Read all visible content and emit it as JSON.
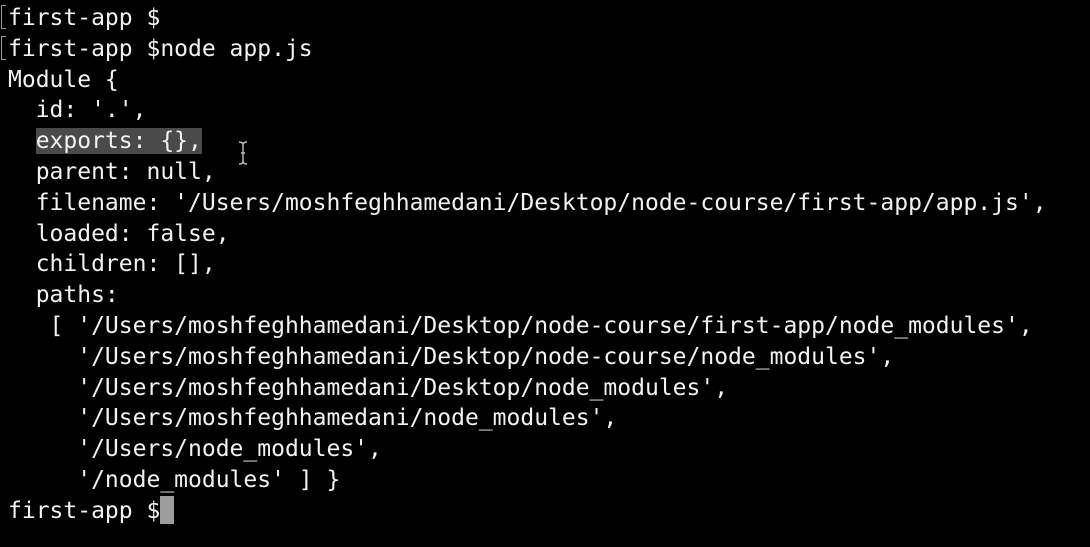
{
  "terminal": {
    "background": "#000000",
    "foreground": "#f2f2f2",
    "selection_color": "#4a4a4a",
    "cursor_color": "#9c9c9c",
    "lines": [
      "first-app $",
      "first-app $node app.js",
      "Module {",
      "  id: '.',",
      "  parent: null,",
      "  filename: '/Users/moshfeghhamedani/Desktop/node-course/first-app/app.js',",
      "  loaded: false,",
      "  children: [],",
      "  paths:",
      "   [ '/Users/moshfeghhamedani/Desktop/node-course/first-app/node_modules',",
      "     '/Users/moshfeghhamedani/Desktop/node-course/node_modules',",
      "     '/Users/moshfeghhamedani/Desktop/node_modules',",
      "     '/Users/moshfeghhamedani/node_modules',",
      "     '/Users/node_modules',",
      "     '/node_modules' ] }",
      "first-app $"
    ],
    "highlight_indent": "  ",
    "highlighted_text": "exports: {},",
    "icons": {
      "text_cursor": "i-beam-icon",
      "prompt_marker": "bracket-marker-icon"
    }
  }
}
